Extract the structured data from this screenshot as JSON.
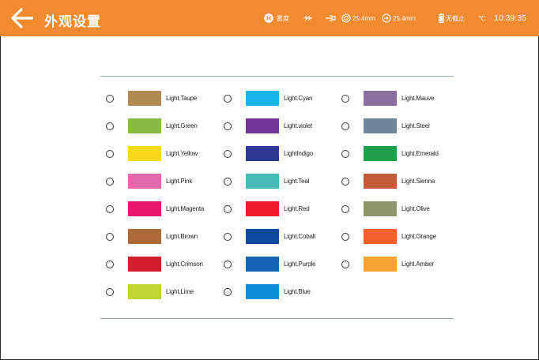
{
  "header": {
    "title": "外观设置",
    "status": {
      "mode_letter": "H",
      "mode_label": "雾度",
      "value1": "25.4mm",
      "value2": "25.4mm",
      "battery_label": "无截止",
      "temp_unit": "℃",
      "time": "10:39:35"
    }
  },
  "colors": {
    "header_bg": "#f28a2f",
    "rule": "#90a4b8"
  },
  "themes": [
    {
      "label": "Light.Taupe",
      "color": "#b08a50"
    },
    {
      "label": "Light.Green",
      "color": "#84ba45"
    },
    {
      "label": "Light.Yellow",
      "color": "#f7d81b"
    },
    {
      "label": "Light.Pink",
      "color": "#e068ab"
    },
    {
      "label": "Light.Magenta",
      "color": "#e8176d"
    },
    {
      "label": "Light.Brown",
      "color": "#ac6a39"
    },
    {
      "label": "Light.Crimson",
      "color": "#d21f2e"
    },
    {
      "label": "Light.Lime",
      "color": "#c0d531"
    },
    {
      "label": "Light.Cyan",
      "color": "#18b4e8"
    },
    {
      "label": "Light.violet",
      "color": "#72339b"
    },
    {
      "label": "LightIndigo",
      "color": "#2e3995"
    },
    {
      "label": "Light.Teal",
      "color": "#46bbb5"
    },
    {
      "label": "Light.Red",
      "color": "#ec1c2a"
    },
    {
      "label": "Light.Cobalt",
      "color": "#0e4aa0"
    },
    {
      "label": "Light.Purple",
      "color": "#1764b4"
    },
    {
      "label": "Light.Blue",
      "color": "#0b8fd6"
    },
    {
      "label": "Light.Mauve",
      "color": "#8b6fa1"
    },
    {
      "label": "Light.Steel",
      "color": "#6f869a"
    },
    {
      "label": "Light.Emerald",
      "color": "#219e4c"
    },
    {
      "label": "Light.Sienna",
      "color": "#c15d3b"
    },
    {
      "label": "Light.Olive",
      "color": "#8e956a"
    },
    {
      "label": "Light.Orange",
      "color": "#f2612b"
    },
    {
      "label": "Light.Amber",
      "color": "#f5a52f"
    }
  ]
}
